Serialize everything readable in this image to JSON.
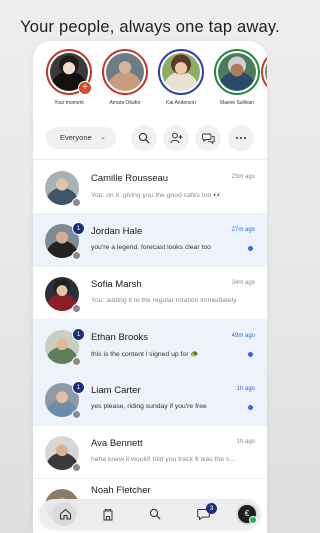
{
  "headline": "Your people, always one tap away.",
  "stories": [
    {
      "name": "Your moment",
      "ring": "red",
      "add": "+"
    },
    {
      "name": "Amara Okafor",
      "ring": "red"
    },
    {
      "name": "Kai Anderson",
      "ring": "blue"
    },
    {
      "name": "Maeve Sullivan",
      "ring": "green"
    },
    {
      "name": "",
      "ring": "red"
    }
  ],
  "filter": {
    "label": "Everyone",
    "chevron": "⌄"
  },
  "chats": [
    {
      "name": "Camille Rousseau",
      "preview": "You: on it. giving you the good cafés too 👀",
      "time": "23m ago",
      "unread": false,
      "badge": ""
    },
    {
      "name": "Jordan Hale",
      "preview": "you're a legend. forecast looks clear too",
      "time": "27m ago",
      "unread": true,
      "badge": "1"
    },
    {
      "name": "Sofia Marsh",
      "preview": "You: adding it to the regular rotation immediately",
      "time": "34m ago",
      "unread": false,
      "badge": ""
    },
    {
      "name": "Ethan Brooks",
      "preview": "this is the content i signed up for 🐢",
      "time": "49m ago",
      "unread": true,
      "badge": "1"
    },
    {
      "name": "Liam Carter",
      "preview": "yes please, riding sunday if you're free",
      "time": "1h ago",
      "unread": true,
      "badge": "1"
    },
    {
      "name": "Ava Bennett",
      "preview": "haha knew it would! told you track 6 was the s...",
      "time": "1h ago",
      "unread": false,
      "badge": ""
    },
    {
      "name": "Noah Fletcher",
      "preview": "",
      "time": "",
      "unread": false,
      "badge": ""
    }
  ],
  "tabbar": {
    "messages_badge": "3",
    "me_initial": "€"
  },
  "colors": {
    "accent": "#1b2f7a",
    "link": "#2e6fd6",
    "unread_bg": "#eef2fb"
  }
}
